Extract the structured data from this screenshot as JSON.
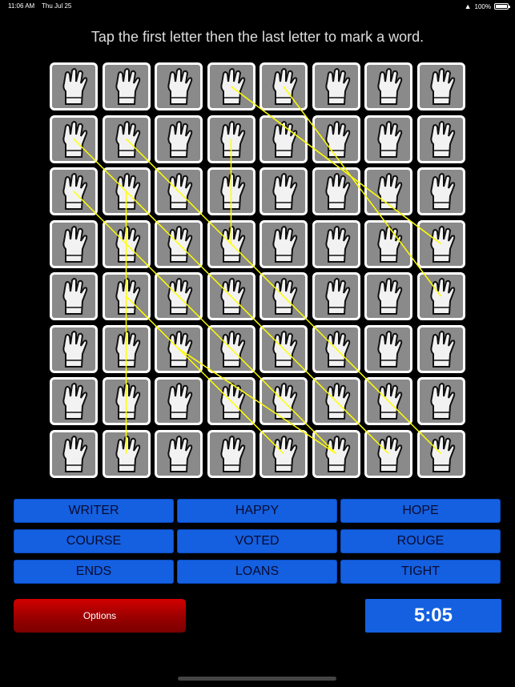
{
  "status_bar": {
    "time": "11:06 AM",
    "date": "Thu Jul 25",
    "battery": "100%"
  },
  "instruction": "Tap the first letter then the last letter to mark a word.",
  "board": {
    "rows": 8,
    "cols": 8,
    "found_lines": [
      [
        [
          1,
          0
        ],
        [
          7,
          6
        ]
      ],
      [
        [
          2,
          0
        ],
        [
          7,
          5
        ]
      ],
      [
        [
          1,
          1
        ],
        [
          7,
          7
        ]
      ],
      [
        [
          0,
          4
        ],
        [
          4,
          7
        ]
      ],
      [
        [
          0,
          3
        ],
        [
          3,
          7
        ]
      ],
      [
        [
          1,
          3
        ],
        [
          3,
          3
        ]
      ],
      [
        [
          2,
          1
        ],
        [
          7,
          1
        ]
      ],
      [
        [
          5,
          2
        ],
        [
          7,
          5
        ]
      ],
      [
        [
          4,
          1
        ],
        [
          7,
          4
        ]
      ]
    ]
  },
  "words": [
    {
      "label": "WRITER"
    },
    {
      "label": "HAPPY"
    },
    {
      "label": "HOPE"
    },
    {
      "label": "COURSE"
    },
    {
      "label": "VOTED"
    },
    {
      "label": "ROUGE"
    },
    {
      "label": "ENDS"
    },
    {
      "label": "LOANS"
    },
    {
      "label": "TIGHT"
    }
  ],
  "options_label": "Options",
  "timer": "5:05",
  "colors": {
    "tile_bg": "#8a8a8a",
    "word_button": "#1460e0",
    "options_button": "#c00000",
    "found_line": "#ffff00"
  }
}
